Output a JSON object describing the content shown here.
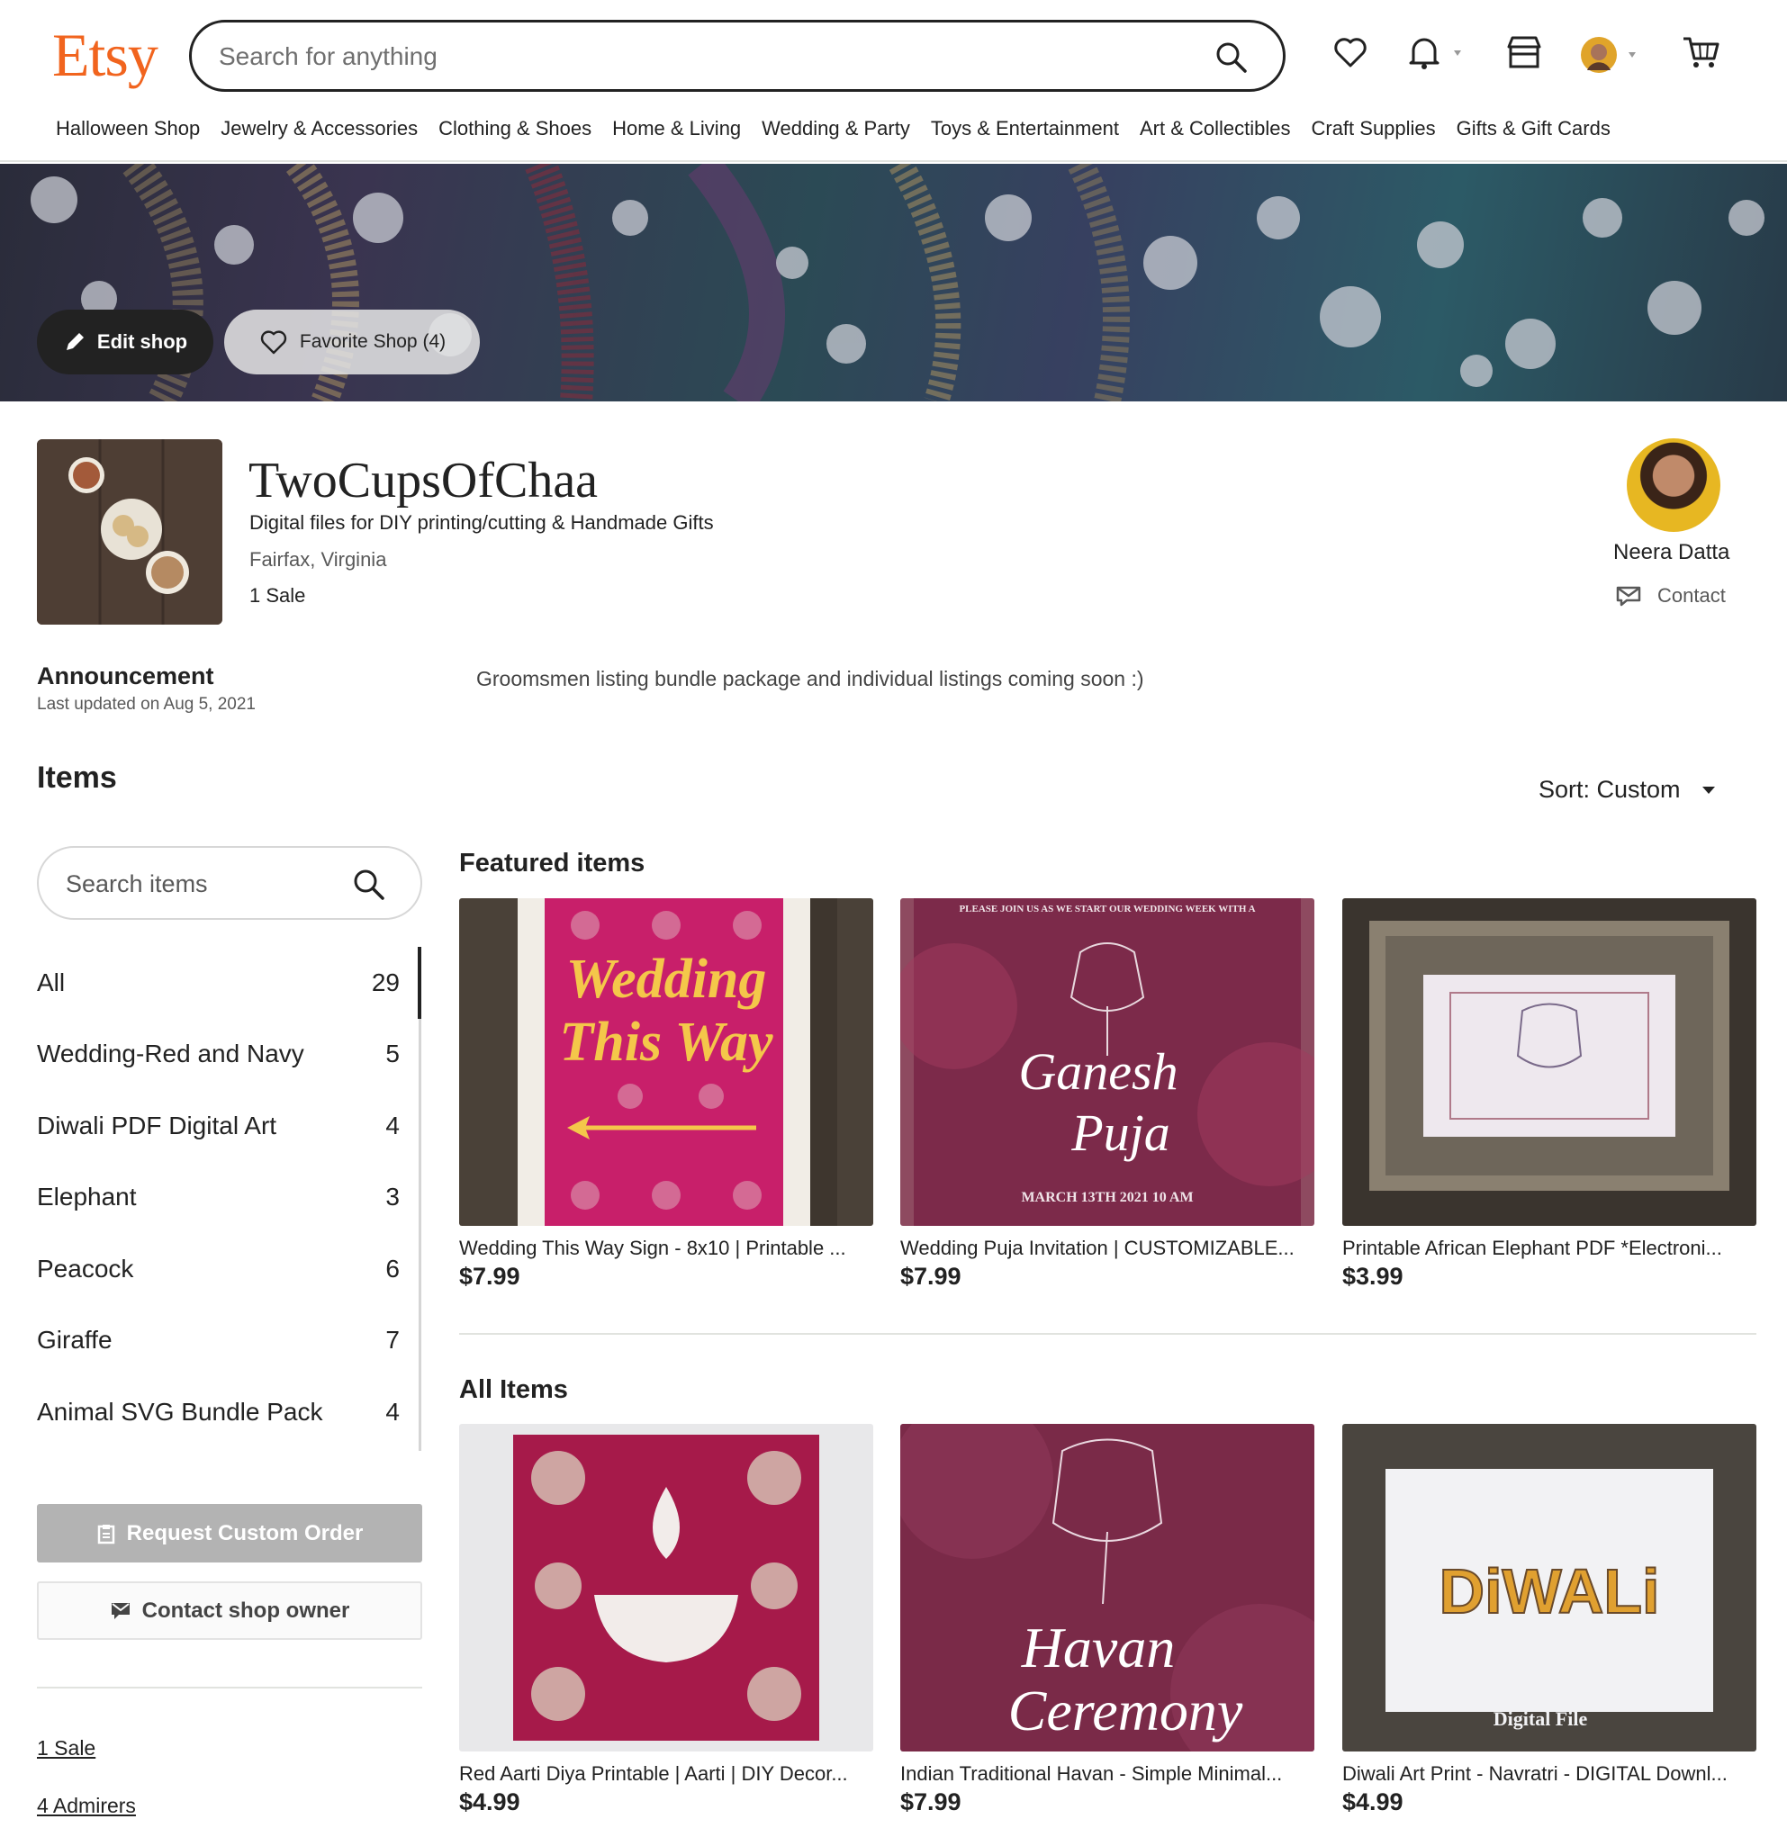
{
  "header": {
    "logo": "Etsy",
    "search_placeholder": "Search for anything",
    "nav": [
      "Halloween Shop",
      "Jewelry & Accessories",
      "Clothing & Shoes",
      "Home & Living",
      "Wedding & Party",
      "Toys & Entertainment",
      "Art & Collectibles",
      "Craft Supplies",
      "Gifts & Gift Cards"
    ],
    "icons": [
      "heart-icon",
      "bell-icon",
      "shop-icon",
      "avatar",
      "cart-icon"
    ]
  },
  "banner": {
    "edit_label": "Edit shop",
    "favorite_label": "Favorite Shop (4)"
  },
  "shop": {
    "name": "TwoCupsOfChaa",
    "tagline": "Digital files for DIY printing/cutting & Handmade Gifts",
    "location": "Fairfax, Virginia",
    "sales": "1 Sale",
    "owner_name": "Neera Datta",
    "contact_label": "Contact"
  },
  "announcement": {
    "title": "Announcement",
    "date": "Last updated on Aug 5, 2021",
    "text": "Groomsmen listing bundle package and individual listings coming soon :)"
  },
  "items": {
    "title": "Items",
    "sort_label": "Sort: Custom",
    "search_placeholder": "Search items",
    "categories": [
      {
        "label": "All",
        "count": "29"
      },
      {
        "label": "Wedding-Red and Navy",
        "count": "5"
      },
      {
        "label": "Diwali PDF Digital Art",
        "count": "4"
      },
      {
        "label": "Elephant",
        "count": "3"
      },
      {
        "label": "Peacock",
        "count": "6"
      },
      {
        "label": "Giraffe",
        "count": "7"
      },
      {
        "label": "Animal SVG Bundle Pack",
        "count": "4"
      }
    ],
    "request_custom_label": "Request Custom Order",
    "contact_owner_label": "Contact shop owner",
    "sales_link": "1 Sale",
    "admirers_link": "4 Admirers"
  },
  "featured": {
    "title": "Featured items",
    "cards": [
      {
        "title": "Wedding This Way Sign - 8x10 | Printable ...",
        "price": "$7.99",
        "art_line1": "Wedding",
        "art_line2": "This Way"
      },
      {
        "title": "Wedding Puja Invitation | CUSTOMIZABLE...",
        "price": "$7.99",
        "art_top": "PLEASE JOIN US AS WE START OUR WEDDING WEEK WITH A",
        "art_line1": "Ganesh",
        "art_line2": "Puja",
        "art_bottom": "MARCH 13TH 2021 10 AM"
      },
      {
        "title": "Printable African Elephant PDF *Electroni...",
        "price": "$3.99"
      }
    ]
  },
  "all_items": {
    "title": "All Items",
    "cards": [
      {
        "title": "Red Aarti Diya Printable | Aarti | DIY Decor...",
        "price": "$4.99"
      },
      {
        "title": "Indian Traditional Havan - Simple Minimal...",
        "price": "$7.99",
        "art_line1": "Havan",
        "art_line2": "Ceremony"
      },
      {
        "title": "Diwali Art Print - Navratri - DIGITAL Downl...",
        "price": "$4.99",
        "art_word": "DiWALi",
        "art_caption": "Digital File"
      }
    ]
  }
}
